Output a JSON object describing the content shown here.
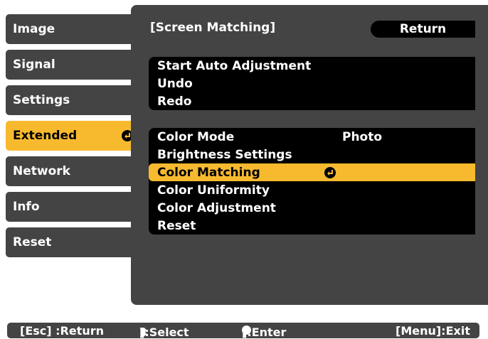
{
  "sidebar": {
    "items": [
      {
        "label": "Image"
      },
      {
        "label": "Signal"
      },
      {
        "label": "Settings"
      },
      {
        "label": "Extended"
      },
      {
        "label": "Network"
      },
      {
        "label": "Info"
      },
      {
        "label": "Reset"
      }
    ],
    "active_index": 3
  },
  "panel": {
    "title": "[Screen Matching]",
    "return_label": "Return",
    "group1": [
      {
        "label": "Start Auto Adjustment"
      },
      {
        "label": "Undo"
      },
      {
        "label": "Redo"
      }
    ],
    "group2": [
      {
        "label": "Color Mode",
        "value": "Photo"
      },
      {
        "label": "Brightness Settings"
      },
      {
        "label": "Color Matching"
      },
      {
        "label": "Color Uniformity"
      },
      {
        "label": "Color Adjustment"
      },
      {
        "label": "Reset"
      }
    ],
    "selected_item": "Color Matching"
  },
  "statusbar": {
    "esc": "[Esc] :Return",
    "select_prefix": "[",
    "select_suffix": "]:Select",
    "enter_prefix": "[",
    "enter_suffix": "]:Enter",
    "menu": "[Menu]:Exit"
  },
  "colors": {
    "panel_bg": "#444444",
    "highlight": "#f7ba2f",
    "menu_bg": "#000000",
    "text": "#ffffff"
  },
  "icons": {
    "enter": "enter-icon",
    "updown": "up-down-arrow-icon"
  }
}
